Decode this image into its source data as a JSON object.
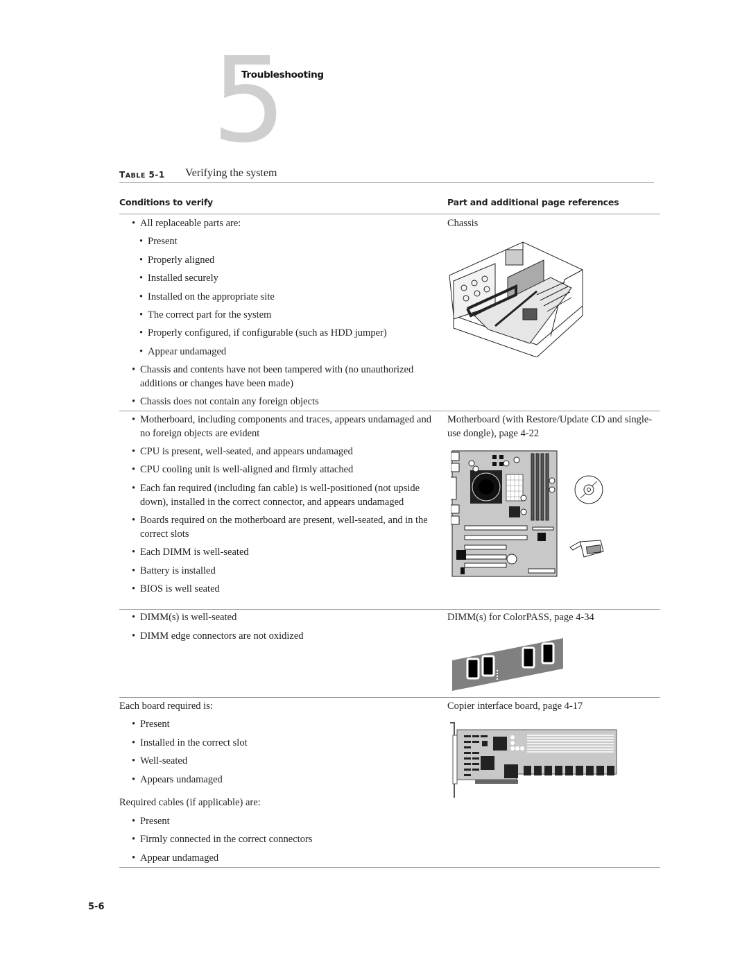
{
  "chapter": {
    "number": "5",
    "title": "Troubleshooting"
  },
  "table": {
    "label_prefix_big": "T",
    "label_prefix_small": "ABLE",
    "label_number": "5-1",
    "title": "Verifying the system",
    "headers": {
      "conditions": "Conditions to verify",
      "parts": "Part and additional page references"
    },
    "rows": [
      {
        "conditions": [
          {
            "level": 1,
            "text": "All replaceable parts are:"
          },
          {
            "level": 2,
            "text": "Present"
          },
          {
            "level": 2,
            "text": "Properly aligned"
          },
          {
            "level": 2,
            "text": "Installed securely"
          },
          {
            "level": 2,
            "text": "Installed on the appropriate site"
          },
          {
            "level": 2,
            "text": "The correct part for the system"
          },
          {
            "level": 2,
            "text": "Properly configured, if configurable (such as HDD jumper)"
          },
          {
            "level": 2,
            "text": "Appear undamaged"
          },
          {
            "level": 1,
            "text": "Chassis and contents have not been tampered with (no unauthorized additions or changes have been made)"
          },
          {
            "level": 1,
            "text": "Chassis does not contain any foreign objects"
          }
        ],
        "reference": "Chassis",
        "figure": "chassis-illustration"
      },
      {
        "conditions": [
          {
            "level": 1,
            "text": "Motherboard, including components and traces, appears undamaged and no foreign objects are evident"
          },
          {
            "level": 1,
            "text": "CPU is present, well-seated, and appears undamaged"
          },
          {
            "level": 1,
            "text": "CPU cooling unit is well-aligned and firmly attached"
          },
          {
            "level": 1,
            "text": "Each fan required (including fan cable) is well-positioned (not upside down), installed in the correct connector, and appears undamaged"
          },
          {
            "level": 1,
            "text": "Boards required on the motherboard are present, well-seated, and in the correct slots"
          },
          {
            "level": 1,
            "text": "Each DIMM is well-seated"
          },
          {
            "level": 1,
            "text": "Battery is installed"
          },
          {
            "level": 1,
            "text": "BIOS is well seated"
          }
        ],
        "reference": "Motherboard (with Restore/Update CD and single-use dongle), page 4-22",
        "figure": "motherboard-illustration"
      },
      {
        "conditions": [
          {
            "level": 1,
            "text": "DIMM(s) is well-seated"
          },
          {
            "level": 1,
            "text": "DIMM edge connectors are not oxidized"
          }
        ],
        "reference": "DIMM(s) for ColorPASS, page 4-34",
        "figure": "dimm-illustration"
      },
      {
        "conditions": [
          {
            "level": 0,
            "text": "Each board required is:"
          },
          {
            "level": 1,
            "text": "Present"
          },
          {
            "level": 1,
            "text": "Installed in the correct slot"
          },
          {
            "level": 1,
            "text": "Well-seated"
          },
          {
            "level": 1,
            "text": "Appears undamaged"
          },
          {
            "level": 0,
            "text": "Required cables (if applicable) are:"
          },
          {
            "level": 1,
            "text": "Present"
          },
          {
            "level": 1,
            "text": "Firmly connected in the correct connectors"
          },
          {
            "level": 1,
            "text": "Appear undamaged"
          }
        ],
        "reference": "Copier interface board, page 4-17",
        "figure": "copier-interface-board-illustration"
      }
    ]
  },
  "page_number": "5-6"
}
